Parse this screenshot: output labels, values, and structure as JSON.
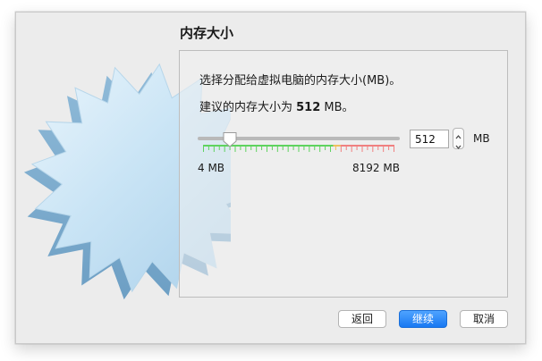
{
  "dialog": {
    "title": "内存大小",
    "description": "选择分配给虚拟电脑的内存大小(MB)。",
    "recommended_prefix": "建议的内存大小为 ",
    "recommended_value": "512",
    "recommended_suffix": " MB。"
  },
  "memory_slider": {
    "min_label": "4 MB",
    "max_label": "8192 MB",
    "min_mb": 4,
    "max_mb": 8192,
    "value_mb": 512,
    "zones": [
      {
        "name": "safe",
        "color": "#5fd35f",
        "until_fraction": 0.68
      },
      {
        "name": "warning",
        "color": "#f0c060",
        "until_fraction": 0.72
      },
      {
        "name": "danger",
        "color": "#f08080",
        "until_fraction": 1.0
      }
    ]
  },
  "memory_input": {
    "value": "512",
    "unit": "MB"
  },
  "buttons": {
    "back": "返回",
    "continue": "继续",
    "cancel": "取消"
  },
  "colors": {
    "accent": "#1778f2",
    "window_bg": "#ececec"
  },
  "icons": {
    "stepper_up": "chevron-up-icon",
    "stepper_down": "chevron-down-icon"
  }
}
